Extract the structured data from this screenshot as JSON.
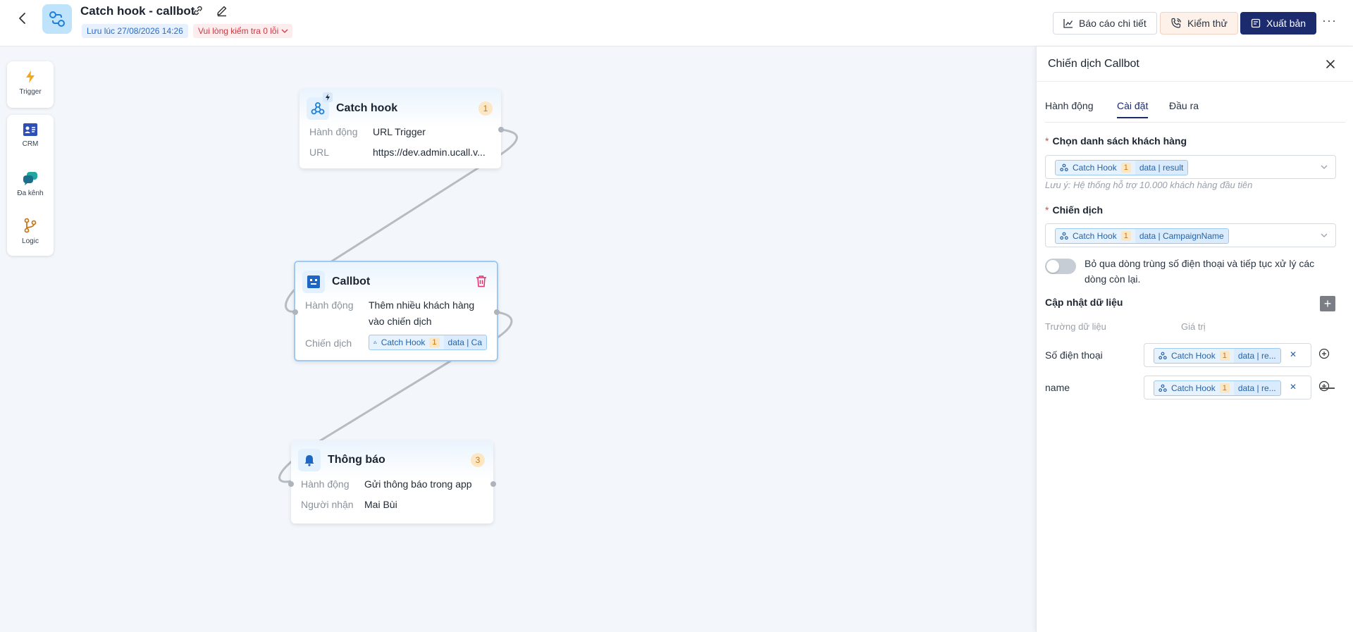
{
  "header": {
    "title": "Catch hook - callbot",
    "saved": "Lưu lúc 27/08/2026 14:26",
    "errors": "Vui lòng kiểm tra 0 lỗi",
    "report_label": "Báo cáo chi tiết",
    "test_label": "Kiểm thử",
    "publish_label": "Xuất bản"
  },
  "palette": {
    "trigger": "Trigger",
    "crm": "CRM",
    "multichannel": "Đa kênh",
    "logic": "Logic"
  },
  "nodes": {
    "catch_hook": {
      "title": "Catch hook",
      "count": "1",
      "action_key": "Hành động",
      "action_val": "URL Trigger",
      "url_key": "URL",
      "url_val": "https://dev.admin.ucall.v..."
    },
    "callbot": {
      "title": "Callbot",
      "action_key": "Hành động",
      "action_val_1": "Thêm nhiều khách hàng",
      "action_val_2": "vào chiến dịch",
      "campaign_key": "Chiến dịch",
      "tag_name": "Catch Hook",
      "tag_num": "1",
      "tag_data": "data | Ca"
    },
    "notify": {
      "title": "Thông báo",
      "count": "3",
      "action_key": "Hành động",
      "action_val": "Gửi thông báo trong app",
      "recipient_key": "Người nhận",
      "recipient_val": "Mai Bùi"
    }
  },
  "panel": {
    "title": "Chiến dịch Callbot",
    "tabs": [
      {
        "label": "Hành động"
      },
      {
        "label": "Cài đặt"
      },
      {
        "label": "Đầu ra"
      }
    ],
    "active_tab": "Cài đặt",
    "customer_list": {
      "label": "Chọn danh sách khách hàng",
      "tag_name": "Catch Hook",
      "tag_num": "1",
      "tag_data": "data | result",
      "hint": "Lưu ý: Hệ thống hỗ trợ 10.000 khách hàng đầu tiên"
    },
    "campaign": {
      "label": "Chiến dịch",
      "tag_name": "Catch Hook",
      "tag_num": "1",
      "tag_data": "data | CampaignName"
    },
    "skip_duplicates": {
      "text": "Bỏ qua dòng trùng số điện thoại và tiếp tục xử lý các dòng còn lại.",
      "enabled": false
    },
    "update_data": {
      "title": "Cập nhật dữ liệu",
      "col_field": "Trường dữ liệu",
      "col_value": "Giá trị",
      "rows": [
        {
          "field": "Số điện thoại",
          "tag_name": "Catch Hook",
          "tag_num": "1",
          "tag_data": "data | re..."
        },
        {
          "field": "name",
          "tag_name": "Catch Hook",
          "tag_num": "1",
          "tag_data": "data | re..."
        }
      ]
    }
  },
  "colors": {
    "brand": "#1c2a6e",
    "accent": "#2663a8",
    "danger": "#c93a44"
  }
}
